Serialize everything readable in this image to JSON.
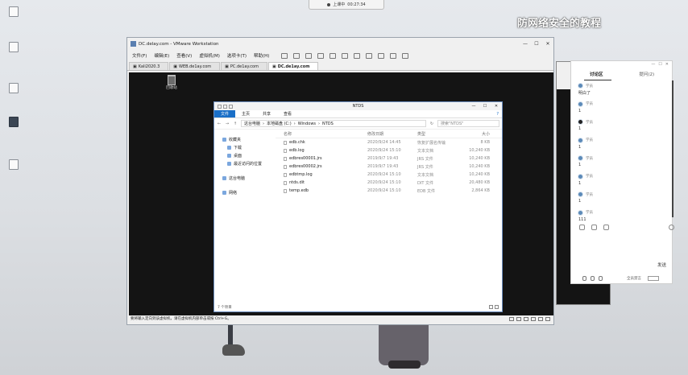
{
  "recording_bar": {
    "label": "上课中",
    "time": "00:27:34"
  },
  "watermark": "防网络安全的教程",
  "desktop_icons": [
    {
      "label": ""
    },
    {
      "label": ""
    },
    {
      "label": ""
    },
    {
      "label": ""
    },
    {
      "label": ""
    }
  ],
  "vmware": {
    "title": "DC.delay.com - VMware Workstation",
    "window_controls": [
      "—",
      "☐",
      "✕"
    ],
    "menu": [
      "文件(F)",
      "编辑(E)",
      "查看(V)",
      "虚拟机(M)",
      "选项卡(T)",
      "帮助(H)"
    ],
    "tabs": [
      "Kali2020.3",
      "WEB.de1ay.com",
      "PC.de1ay.com",
      "DC.de1ay.com"
    ],
    "active_tab_index": 3,
    "status_text": "要将输入定向到该虚拟机，请在虚拟机内部单击或按 Ctrl+G。"
  },
  "guest_desktop": {
    "recycle_bin_label": "回收站"
  },
  "explorer": {
    "title": "NTDS",
    "window_controls": [
      "—",
      "☐",
      "✕"
    ],
    "ribbon_tabs": [
      "文件",
      "主页",
      "共享",
      "查看"
    ],
    "path": [
      "这台电脑",
      "本地磁盘 (C:)",
      "Windows",
      "NTDS"
    ],
    "search_placeholder": "搜索\"NTDS\"",
    "nav": {
      "favorites": "收藏夹",
      "favorites_items": [
        "下载",
        "桌面",
        "最近访问的位置"
      ],
      "this_pc": "这台电脑",
      "network": "网络"
    },
    "columns": {
      "name": "名称",
      "date": "修改日期",
      "type": "类型",
      "size": "大小"
    },
    "files": [
      {
        "name": "edb.chk",
        "date": "2020/9/24 14:45",
        "type": "恢复扩展名传输",
        "size": "8 KB"
      },
      {
        "name": "edb.log",
        "date": "2020/9/24 15:10",
        "type": "文本文档",
        "size": "10,240 KB"
      },
      {
        "name": "edbres00001.jrs",
        "date": "2019/9/7 19:43",
        "type": "JRS 文件",
        "size": "10,240 KB"
      },
      {
        "name": "edbres00002.jrs",
        "date": "2019/9/7 19:43",
        "type": "JRS 文件",
        "size": "10,240 KB"
      },
      {
        "name": "edbtmp.log",
        "date": "2020/9/24 15:10",
        "type": "文本文档",
        "size": "10,240 KB"
      },
      {
        "name": "ntds.dit",
        "date": "2020/9/24 15:10",
        "type": "DIT 文件",
        "size": "20,480 KB"
      },
      {
        "name": "temp.edb",
        "date": "2020/9/24 15:10",
        "type": "EDB 文件",
        "size": "2,864 KB"
      }
    ],
    "status": "7 个项目"
  },
  "chat": {
    "window_controls": [
      "—",
      "☐",
      "✕"
    ],
    "tabs": [
      "讨论区",
      "提问(2)"
    ],
    "messages": [
      {
        "user": "学员",
        "text": "明白了"
      },
      {
        "user": "学员",
        "text": "1"
      },
      {
        "user": "学员",
        "text": "1"
      },
      {
        "user": "学员",
        "text": "1"
      },
      {
        "user": "学员",
        "text": "1"
      },
      {
        "user": "学员",
        "text": "1"
      },
      {
        "user": "学员",
        "text": "1"
      },
      {
        "user": "学员",
        "text": "111"
      }
    ],
    "send_label": "发送",
    "bottom_label": "全员禁言"
  }
}
